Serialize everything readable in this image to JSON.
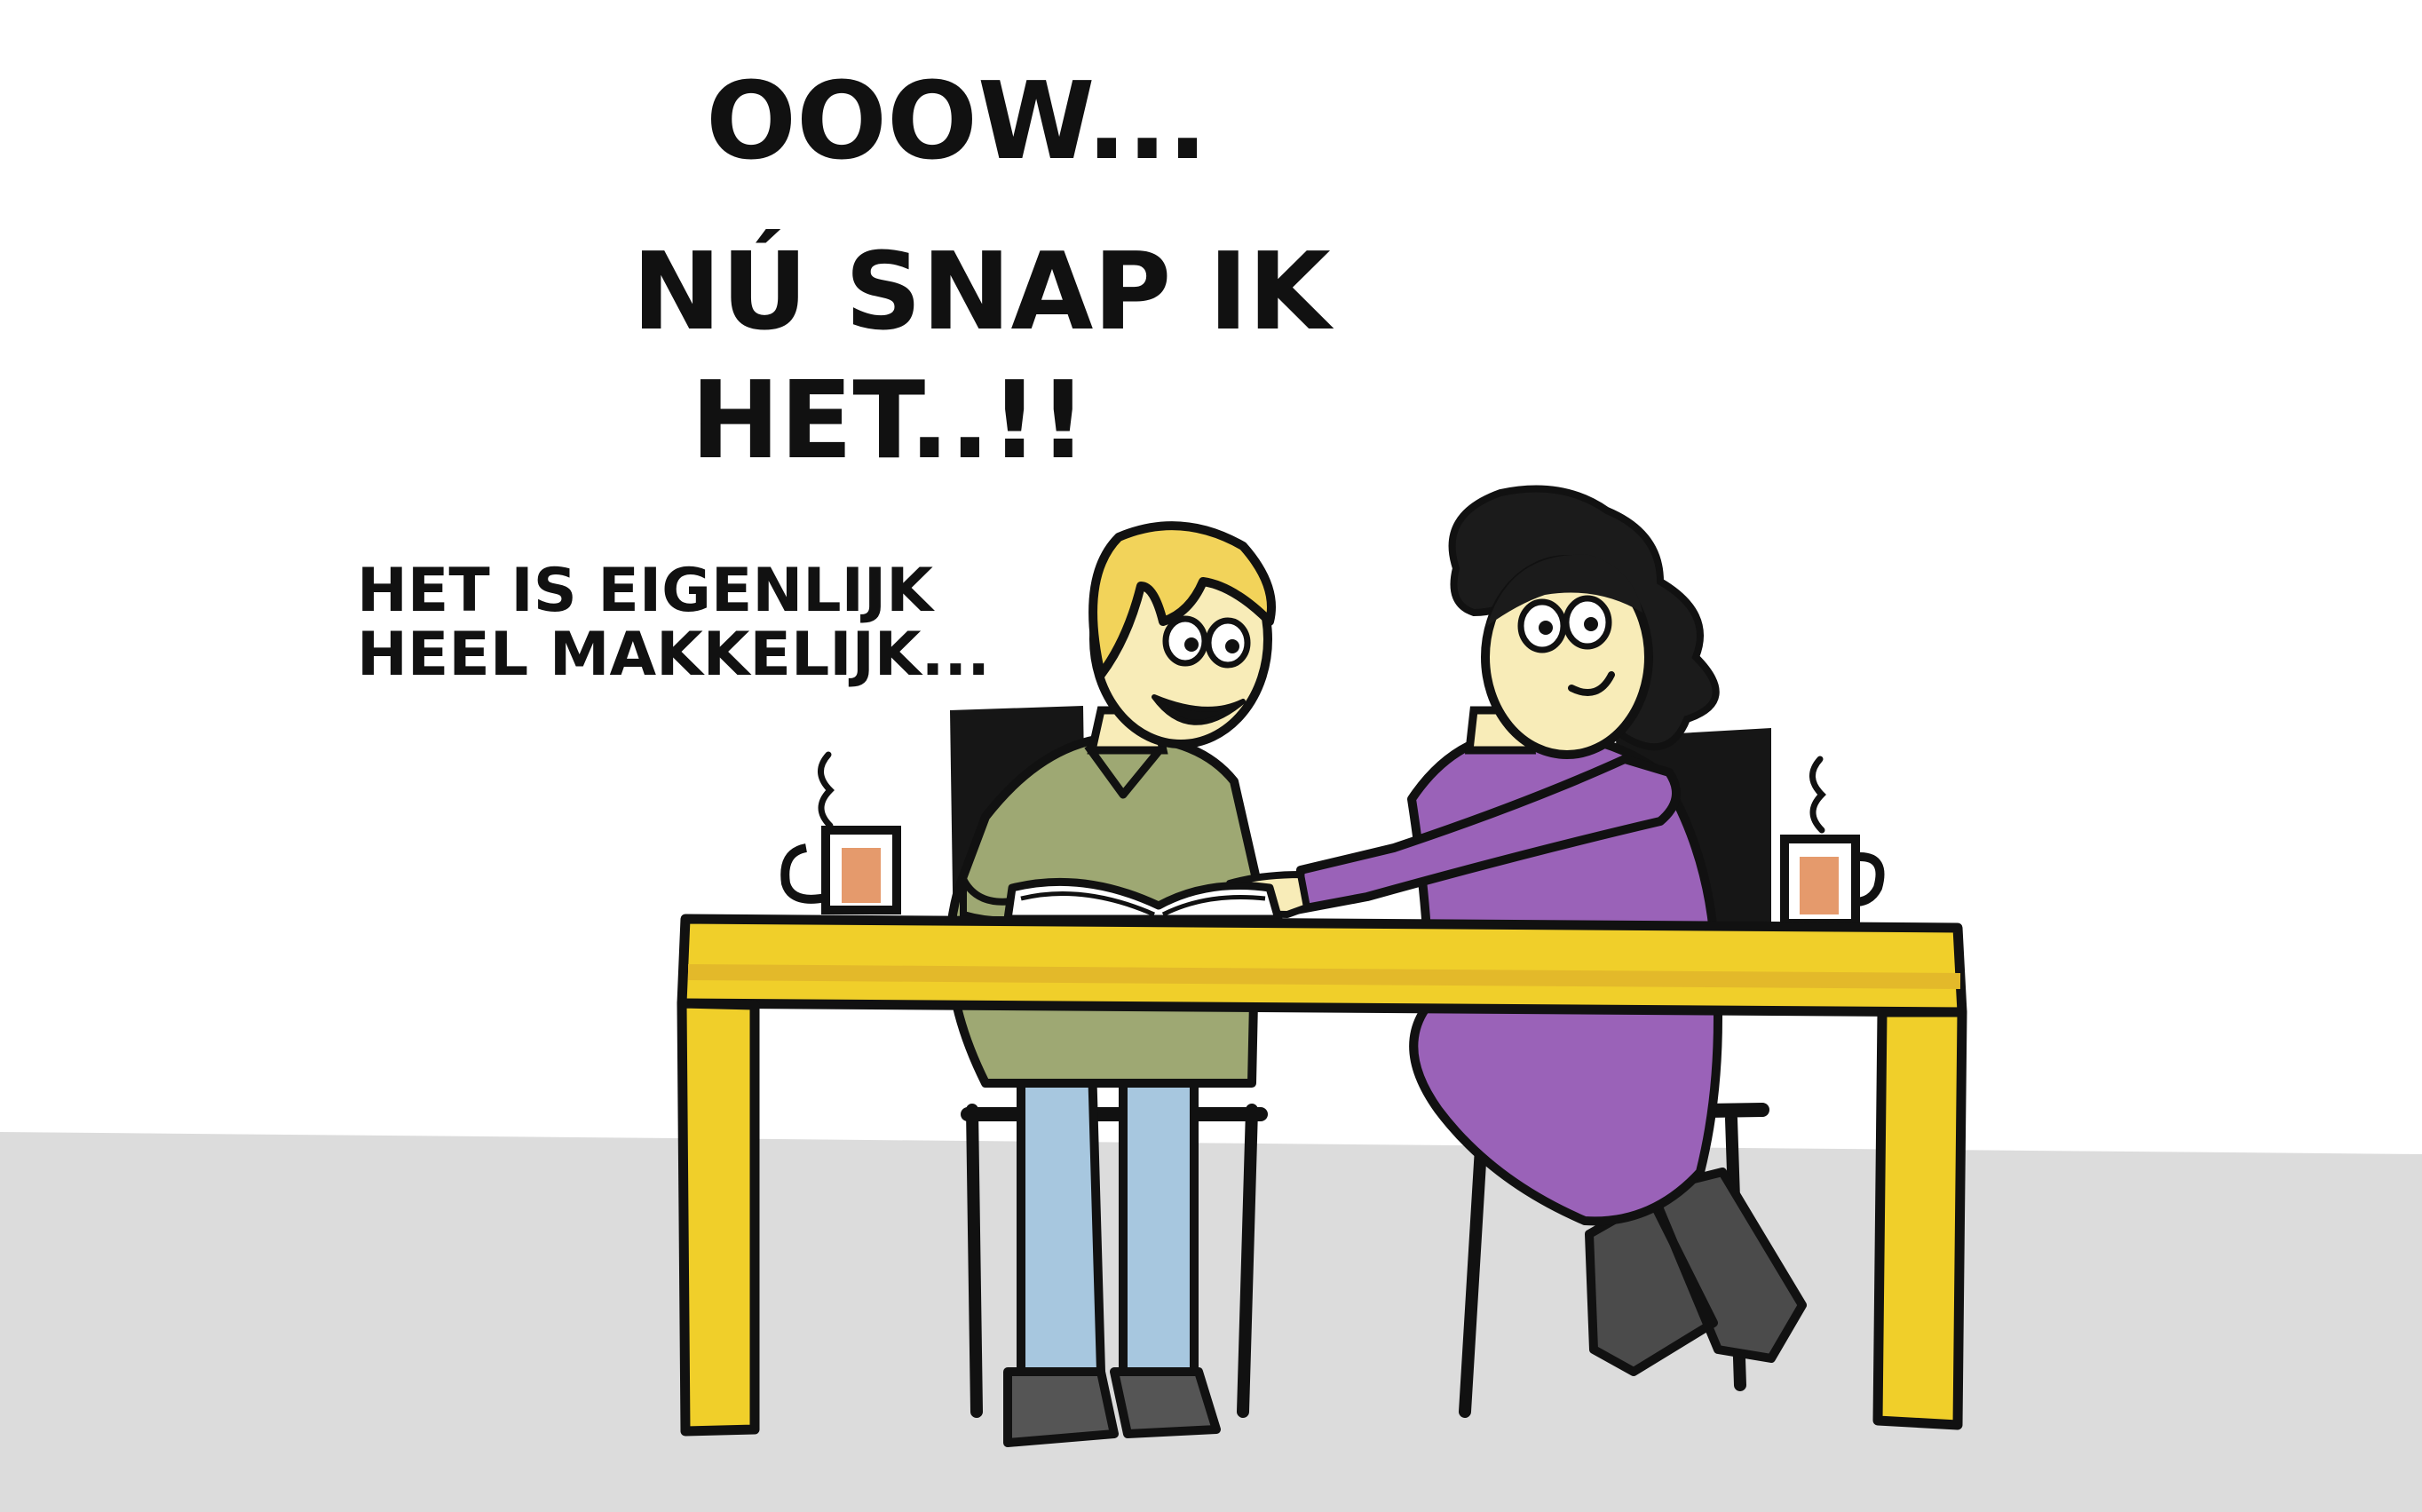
{
  "speech": {
    "big_line_1": "OOOW...",
    "big_line_2": "NÚ SNAP IK",
    "big_line_3": "HET..!!",
    "small_line_1": "HET IS EIGENLIJK",
    "small_line_2": "HEEL MAKKELIJK..."
  },
  "colors": {
    "background": "#ffffff",
    "floor": "#dcdcdc",
    "table": "#f0cf2a",
    "table_shade": "#e3b92a",
    "outline": "#111111",
    "skin": "#f8ecb8",
    "blond_hair": "#f2d35a",
    "dark_hair": "#1b1b1b",
    "green_sweater": "#9ea873",
    "jeans": "#a7c7df",
    "purple_dress": "#9a62b8",
    "boots": "#4b4b4b",
    "tea": "#e59a6c",
    "chair": "#161616"
  }
}
